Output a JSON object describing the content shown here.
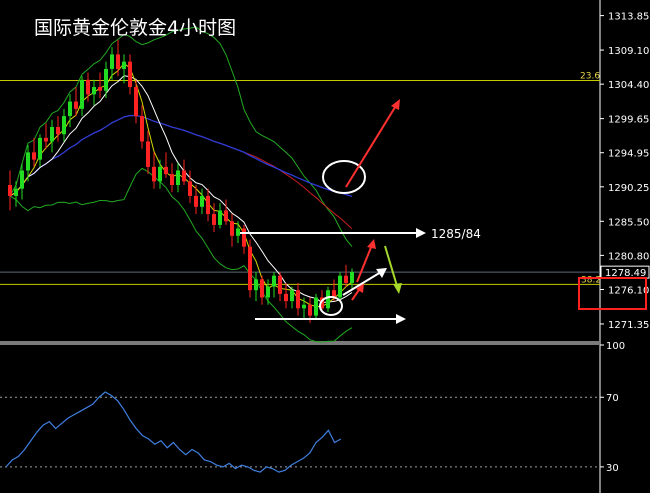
{
  "window": {
    "title": "国际黄金伦敦金4小时图"
  },
  "annotations": {
    "target_label": "1285/84"
  },
  "colors": {
    "background": "#000000",
    "bull_candle": "#22dd22",
    "bear_candle": "#ff2222",
    "fib_line": "#c8c800",
    "ma_red": "#c81e1e",
    "ma_blue": "#2b3cd6",
    "ma_white": "#ffffff",
    "ma_yellow": "#d8d800",
    "bollinger": "#22aa22",
    "indicator_line": "#3f7fe0",
    "arrow_red": "#ff3030",
    "arrow_white": "#ffffff",
    "arrow_yellow_green": "#a6d82a",
    "highlight_box": "#ff2020"
  },
  "chart_data": [
    {
      "type": "candlestick",
      "title": "国际黄金伦敦金4小时图",
      "yticks": [
        "1313.85",
        "1309.10",
        "1304.40",
        "1299.65",
        "1294.95",
        "1290.25",
        "1285.50",
        "1280.80",
        "1276.10",
        "1271.35"
      ],
      "ylim": [
        1269.0,
        1316.0
      ],
      "current_price": "1278.49",
      "fib_levels": [
        {
          "label": "23.6",
          "price": 1304.9
        },
        {
          "label": "38.2",
          "price": 1276.8
        }
      ],
      "candles": [
        [
          1290.5,
          1292.5,
          1287.0,
          1289.0
        ],
        [
          1289.0,
          1291.0,
          1287.5,
          1290.0
        ],
        [
          1290.0,
          1293.5,
          1288.5,
          1292.5
        ],
        [
          1292.5,
          1296.0,
          1291.0,
          1295.0
        ],
        [
          1295.0,
          1297.0,
          1293.0,
          1294.0
        ],
        [
          1294.0,
          1297.5,
          1293.0,
          1297.0
        ],
        [
          1297.0,
          1299.0,
          1295.5,
          1296.5
        ],
        [
          1296.5,
          1299.5,
          1295.0,
          1298.5
        ],
        [
          1298.5,
          1300.0,
          1296.5,
          1297.5
        ],
        [
          1297.5,
          1301.0,
          1296.5,
          1300.0
        ],
        [
          1300.0,
          1303.0,
          1298.5,
          1302.0
        ],
        [
          1302.0,
          1304.0,
          1300.0,
          1301.0
        ],
        [
          1301.0,
          1305.5,
          1300.0,
          1305.0
        ],
        [
          1305.0,
          1306.0,
          1302.0,
          1303.0
        ],
        [
          1303.0,
          1305.0,
          1301.5,
          1304.0
        ],
        [
          1304.0,
          1306.0,
          1302.5,
          1303.5
        ],
        [
          1303.5,
          1307.5,
          1302.5,
          1306.5
        ],
        [
          1306.5,
          1309.5,
          1305.0,
          1308.5
        ],
        [
          1308.5,
          1310.5,
          1305.5,
          1306.5
        ],
        [
          1306.5,
          1308.5,
          1304.5,
          1307.5
        ],
        [
          1307.5,
          1308.5,
          1303.0,
          1304.0
        ],
        [
          1304.0,
          1305.0,
          1299.0,
          1300.0
        ],
        [
          1300.0,
          1301.5,
          1295.5,
          1296.5
        ],
        [
          1296.5,
          1298.0,
          1292.0,
          1293.0
        ],
        [
          1293.0,
          1295.0,
          1290.0,
          1291.0
        ],
        [
          1291.0,
          1294.0,
          1290.0,
          1293.0
        ],
        [
          1293.0,
          1295.0,
          1291.5,
          1292.0
        ],
        [
          1292.0,
          1293.5,
          1289.5,
          1290.5
        ],
        [
          1290.5,
          1293.5,
          1289.5,
          1292.5
        ],
        [
          1292.5,
          1294.0,
          1290.5,
          1291.0
        ],
        [
          1291.0,
          1292.5,
          1288.0,
          1289.0
        ],
        [
          1289.0,
          1290.5,
          1286.5,
          1287.5
        ],
        [
          1287.5,
          1290.0,
          1286.5,
          1289.0
        ],
        [
          1289.0,
          1290.0,
          1285.5,
          1286.5
        ],
        [
          1286.5,
          1288.0,
          1284.0,
          1285.0
        ],
        [
          1285.0,
          1288.0,
          1284.5,
          1287.0
        ],
        [
          1287.0,
          1288.5,
          1285.0,
          1285.5
        ],
        [
          1285.5,
          1286.5,
          1282.0,
          1283.5
        ],
        [
          1283.5,
          1285.5,
          1282.5,
          1284.5
        ],
        [
          1284.5,
          1285.0,
          1281.0,
          1282.0
        ],
        [
          1282.0,
          1283.0,
          1275.0,
          1276.0
        ],
        [
          1276.0,
          1278.5,
          1274.5,
          1277.5
        ],
        [
          1277.5,
          1278.0,
          1274.0,
          1275.0
        ],
        [
          1275.0,
          1277.5,
          1274.0,
          1276.5
        ],
        [
          1276.5,
          1278.5,
          1275.0,
          1278.0
        ],
        [
          1278.0,
          1278.5,
          1274.5,
          1275.5
        ],
        [
          1275.5,
          1277.0,
          1273.5,
          1274.5
        ],
        [
          1274.5,
          1276.5,
          1273.5,
          1276.0
        ],
        [
          1276.0,
          1277.0,
          1272.5,
          1273.5
        ],
        [
          1273.5,
          1275.0,
          1272.0,
          1274.0
        ],
        [
          1274.0,
          1275.0,
          1271.5,
          1272.5
        ],
        [
          1272.5,
          1275.5,
          1272.0,
          1275.0
        ],
        [
          1275.0,
          1276.0,
          1273.0,
          1273.5
        ],
        [
          1273.5,
          1276.5,
          1273.0,
          1276.0
        ],
        [
          1276.0,
          1277.5,
          1274.5,
          1275.0
        ],
        [
          1275.0,
          1278.5,
          1274.5,
          1278.0
        ],
        [
          1278.0,
          1279.5,
          1276.5,
          1277.0
        ],
        [
          1277.0,
          1279.0,
          1276.0,
          1278.5
        ]
      ]
    },
    {
      "type": "line",
      "title": "",
      "yticks": [
        "100",
        "70",
        "30"
      ],
      "ylim": [
        15,
        100
      ],
      "levels": [
        70,
        30
      ],
      "values": [
        30,
        34,
        36,
        40,
        45,
        50,
        54,
        56,
        52,
        55,
        58,
        60,
        62,
        64,
        66,
        70,
        73,
        71,
        68,
        63,
        57,
        52,
        48,
        46,
        43,
        45,
        41,
        44,
        40,
        37,
        40,
        38,
        34,
        33,
        31,
        30,
        32,
        29,
        31,
        30,
        28,
        27,
        30,
        29,
        27,
        28,
        31,
        33,
        35,
        38,
        44,
        47,
        51,
        44,
        46
      ]
    }
  ]
}
